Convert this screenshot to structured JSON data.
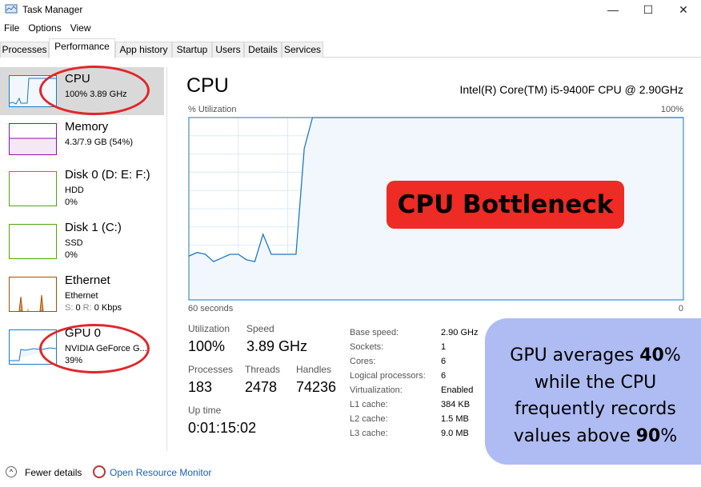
{
  "window": {
    "title": "Task Manager",
    "controls": [
      "minimize",
      "maximize",
      "close"
    ]
  },
  "menu": [
    "File",
    "Options",
    "View"
  ],
  "tabs": [
    {
      "label": "Processes"
    },
    {
      "label": "Performance",
      "active": true
    },
    {
      "label": "App history"
    },
    {
      "label": "Startup"
    },
    {
      "label": "Users"
    },
    {
      "label": "Details"
    },
    {
      "label": "Services"
    }
  ],
  "sidebar": [
    {
      "title": "CPU",
      "line1": "100%  3.89 GHz",
      "line2": "",
      "color": "#1b7ac2",
      "selected": true
    },
    {
      "title": "Memory",
      "line1": "4.3/7.9 GB (54%)",
      "line2": "",
      "color": "#8b12ae"
    },
    {
      "title": "Disk 0 (D: E: F:)",
      "line1": "HDD",
      "line2": "0%",
      "color": "#4da60c"
    },
    {
      "title": "Disk 1 (C:)",
      "line1": "SSD",
      "line2": "0%",
      "color": "#4da60c"
    },
    {
      "title": "Ethernet",
      "line1": "Ethernet",
      "line2_s": "S:",
      "line2_sv": "0",
      "line2_r": "R:",
      "line2_rv": "0 Kbps",
      "color": "#a74f01"
    },
    {
      "title": "GPU 0",
      "line1": "NVIDIA GeForce G...",
      "line2": "39%",
      "color": "#1b7ac2"
    }
  ],
  "main": {
    "title": "CPU",
    "model": "Intel(R) Core(TM) i5-9400F CPU @ 2.90GHz",
    "stats": {
      "utilization_label": "Utilization",
      "utilization": "100%",
      "speed_label": "Speed",
      "speed": "3.89 GHz",
      "processes_label": "Processes",
      "processes": "183",
      "threads_label": "Threads",
      "threads": "2478",
      "handles_label": "Handles",
      "handles": "74236",
      "uptime_label": "Up time",
      "uptime": "0:01:15:02"
    },
    "specs": [
      [
        "Base speed:",
        "2.90 GHz"
      ],
      [
        "Sockets:",
        "1"
      ],
      [
        "Cores:",
        "6"
      ],
      [
        "Logical processors:",
        "6"
      ],
      [
        "Virtualization:",
        "Enabled"
      ],
      [
        "L1 cache:",
        "384 KB"
      ],
      [
        "L2 cache:",
        "1.5 MB"
      ],
      [
        "L3 cache:",
        "9.0 MB"
      ]
    ]
  },
  "chart_data": {
    "type": "area",
    "ylabel": "% Utilization",
    "ymax_label": "100%",
    "xmin_label": "60 seconds",
    "xmax_label": "0",
    "ylim": [
      0,
      100
    ],
    "xlim": [
      60,
      0
    ],
    "grid": true,
    "color": "#1b7ac2",
    "x": [
      60,
      59,
      58,
      57,
      56,
      55,
      54,
      53,
      52,
      51,
      50,
      49,
      47,
      46,
      45,
      0
    ],
    "values": [
      24,
      26,
      25,
      21,
      23,
      25,
      25,
      22,
      21,
      36,
      25,
      25,
      25,
      83,
      100,
      100
    ]
  },
  "annotations": {
    "bottleneck": "CPU Bottleneck",
    "note": [
      [
        {
          "t": "GPU averages "
        },
        {
          "t": "40",
          "b": true
        },
        {
          "t": "%"
        }
      ],
      [
        {
          "t": "while the CPU"
        }
      ],
      [
        {
          "t": "frequently records"
        }
      ],
      [
        {
          "t": "values above "
        },
        {
          "t": "90",
          "b": true
        },
        {
          "t": "%"
        }
      ]
    ]
  },
  "footer": {
    "fewer": "Fewer details",
    "monitor": "Open Resource Monitor"
  }
}
